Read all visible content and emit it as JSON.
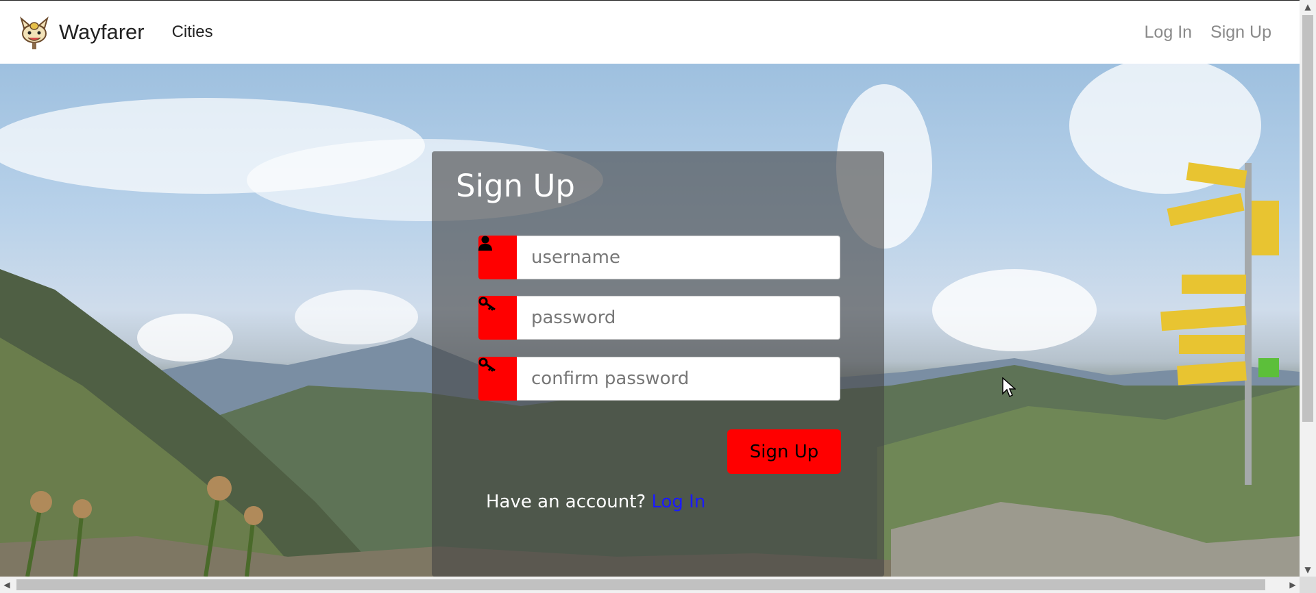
{
  "navbar": {
    "brand": "Wayfarer",
    "cities_label": "Cities",
    "login_label": "Log In",
    "signup_label": "Sign Up",
    "logo_icon": "meowth-logo"
  },
  "form": {
    "title": "Sign Up",
    "username_placeholder": "username",
    "password_placeholder": "password",
    "confirm_placeholder": "confirm password",
    "submit_label": "Sign Up",
    "account_prompt": "Have an account?",
    "login_link": "Log In",
    "user_icon": "user-icon",
    "key_icon": "key-icon"
  },
  "colors": {
    "accent": "#ff0000",
    "link": "#1a1aff",
    "card_overlay": "rgba(70,70,70,0.62)"
  }
}
